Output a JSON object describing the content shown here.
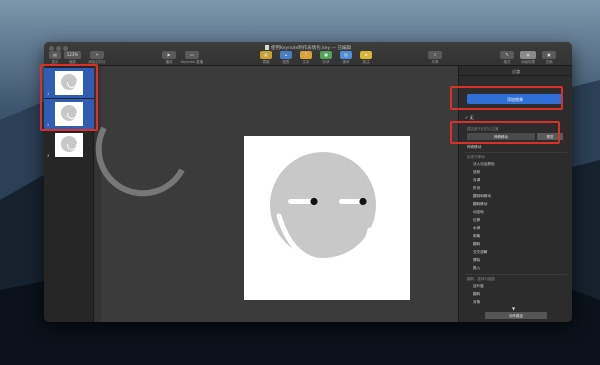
{
  "window": {
    "title": "使用Keynote制作表情包.key — 已编辑"
  },
  "toolbar": {
    "view": "显示",
    "zoom_value": "123%",
    "zoom": "缩放",
    "add_slide": "添加幻灯片",
    "play": "播放",
    "keynote_live": "Keynote 直播",
    "table": "表格",
    "chart": "图表",
    "text": "文本",
    "shape": "形状",
    "media": "媒体",
    "comment": "批注",
    "share": "共享",
    "format": "格式",
    "animate": "动画效果",
    "document": "文稿"
  },
  "navigator": {
    "slides": [
      {
        "number": "1",
        "selected": true
      },
      {
        "number": "2",
        "selected": true
      },
      {
        "number": "3",
        "selected": false
      }
    ]
  },
  "inspector": {
    "title": "过渡",
    "add_effect": "添加效果",
    "none": "无",
    "checked_mark": "✓",
    "magic_move_header": "建议用于幻灯片过渡",
    "magic_move": "神奇移动",
    "preview": "预览",
    "magic_move_item": "神奇移动",
    "common_header": "出现与移动",
    "common_items": [
      "淡入淡出颜色",
      "放射",
      "对调",
      "折页",
      "翻到和移动",
      "翻转移动",
      "动态地",
      "位移",
      "水滴",
      "剥离",
      "翻转",
      "交叉溶解",
      "擦除",
      "推入"
    ],
    "other_header": "翻转、旋转与缩放",
    "other_items": [
      "百叶窗",
      "翻转",
      "对角"
    ],
    "animate_button": "动作路径"
  },
  "colors": {
    "accent": "#2f6fd6",
    "highlight": "#d9302a",
    "face": "#c8c8c8"
  }
}
